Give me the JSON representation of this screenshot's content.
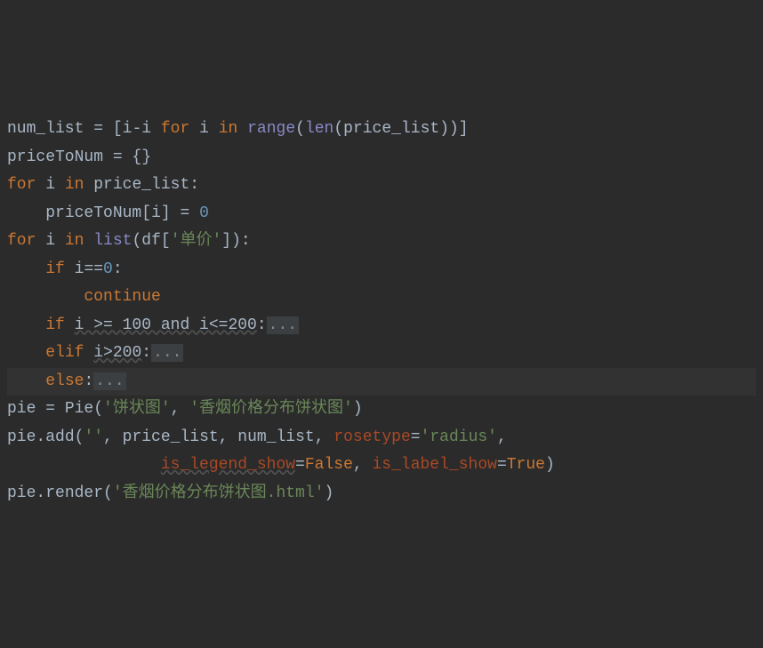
{
  "lines": {
    "l1": {
      "var1": "num_list",
      "eq": " = [",
      "var2": "i",
      "op1": "-",
      "var3": "i ",
      "kw1": "for ",
      "var4": "i ",
      "kw2": "in ",
      "fn1": "range",
      "p1": "(",
      "fn2": "len",
      "p2": "(",
      "var5": "price_list",
      "p3": "))]"
    },
    "l2": {
      "var1": "priceToNum",
      "eq": " = {}"
    },
    "l3": {
      "kw1": "for ",
      "var1": "i ",
      "kw2": "in ",
      "var2": "price_list",
      "colon": ":"
    },
    "l4": {
      "indent": "    ",
      "var1": "priceToNum",
      "br1": "[",
      "var2": "i",
      "br2": "] = ",
      "num": "0"
    },
    "l5": {
      "kw1": "for ",
      "var1": "i ",
      "kw2": "in ",
      "fn1": "list",
      "p1": "(",
      "var2": "df",
      "br1": "[",
      "str1": "'单价'",
      "br2": "]):"
    },
    "l6": {
      "indent": "    ",
      "kw1": "if ",
      "var1": "i",
      "op1": "==",
      "num1": "0",
      "colon": ":"
    },
    "l7": {
      "indent": "        ",
      "kw1": "continue"
    },
    "l8": {
      "indent": "    ",
      "kw1": "if ",
      "cond": "i >= 100 and i<=200",
      "colon": ":",
      "fold": "..."
    },
    "l9": {
      "indent": "    ",
      "kw1": "elif ",
      "cond": "i>200",
      "colon": ":",
      "fold": "..."
    },
    "l10": {
      "indent": "    ",
      "kw1": "else",
      "colon": ":",
      "fold": "..."
    },
    "l11": {
      "var1": "pie",
      "eq": " = ",
      "fn1": "Pie",
      "p1": "(",
      "str1": "'饼状图'",
      "comma": ", ",
      "str2": "'香烟价格分布饼状图'",
      "p2": ")"
    },
    "l12": {
      "var1": "pie",
      "dot": ".",
      "fn1": "add",
      "p1": "(",
      "str1": "''",
      "c1": ", ",
      "var2": "price_list",
      "c2": ", ",
      "var3": "num_list",
      "c3": ", ",
      "param1": "rosetype",
      "eq1": "=",
      "str2": "'radius'",
      "c4": ","
    },
    "l13": {
      "indent": "                ",
      "param1": "is_legend_show",
      "eq1": "=",
      "bool1": "False",
      "c1": ", ",
      "param2": "is_label_show",
      "eq2": "=",
      "bool2": "True",
      "p1": ")"
    },
    "l14": {
      "var1": "pie",
      "dot": ".",
      "fn1": "render",
      "p1": "(",
      "str1": "'香烟价格分布饼状图.html'",
      "p2": ")"
    }
  }
}
